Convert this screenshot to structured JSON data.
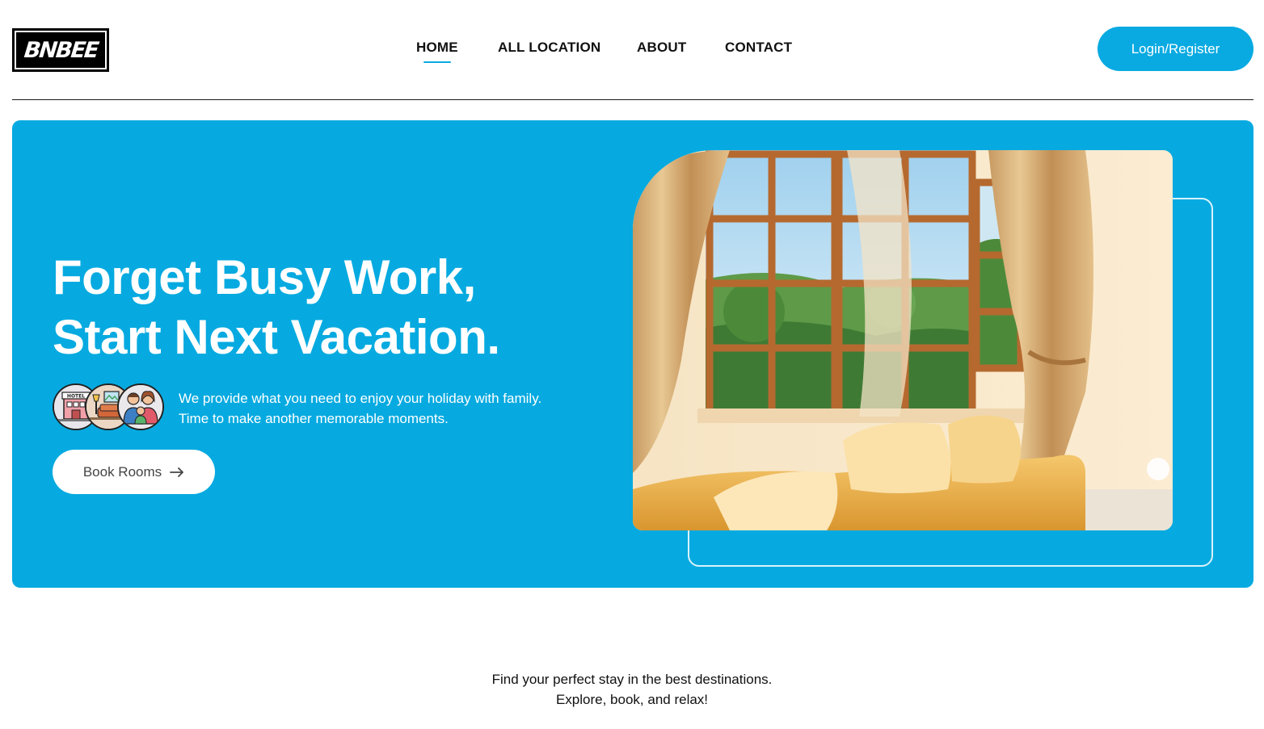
{
  "brand": {
    "logo_text": "BNBEE"
  },
  "nav": {
    "items": [
      {
        "label": "HOME",
        "active": true
      },
      {
        "label": "ALL LOCATION",
        "active": false
      },
      {
        "label": "ABOUT",
        "active": false
      },
      {
        "label": "CONTACT",
        "active": false
      }
    ]
  },
  "header": {
    "login_label": "Login/Register"
  },
  "hero": {
    "title_line1": "Forget Busy Work,",
    "title_line2": "Start Next Vacation.",
    "desc_line1": "We provide what you need to enjoy your holiday with family.",
    "desc_line2": "Time to make another memorable moments.",
    "avatar_icons": [
      "hotel-icon",
      "living-room-icon",
      "family-icon"
    ],
    "avatar_hotel_label": "HOTEL",
    "book_label": "Book Rooms",
    "photo_subject": "sunlit room with window and sofa"
  },
  "tagline": {
    "line1": "Find your perfect stay in the best destinations.",
    "line2": "Explore, book, and relax!"
  },
  "colors": {
    "accent": "#06aae0",
    "button": "#08aae1",
    "text": "#111111",
    "white": "#ffffff"
  }
}
